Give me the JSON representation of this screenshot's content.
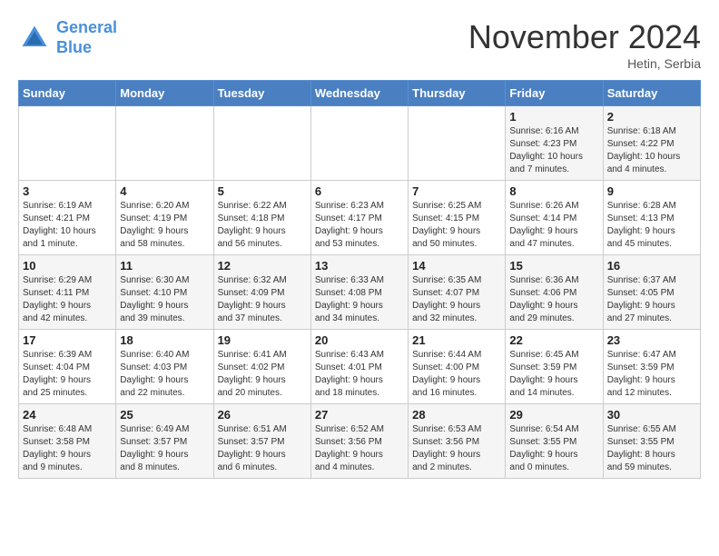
{
  "header": {
    "logo_line1": "General",
    "logo_line2": "Blue",
    "month_title": "November 2024",
    "location": "Hetin, Serbia"
  },
  "weekdays": [
    "Sunday",
    "Monday",
    "Tuesday",
    "Wednesday",
    "Thursday",
    "Friday",
    "Saturday"
  ],
  "weeks": [
    [
      {
        "day": "",
        "info": ""
      },
      {
        "day": "",
        "info": ""
      },
      {
        "day": "",
        "info": ""
      },
      {
        "day": "",
        "info": ""
      },
      {
        "day": "",
        "info": ""
      },
      {
        "day": "1",
        "info": "Sunrise: 6:16 AM\nSunset: 4:23 PM\nDaylight: 10 hours\nand 7 minutes."
      },
      {
        "day": "2",
        "info": "Sunrise: 6:18 AM\nSunset: 4:22 PM\nDaylight: 10 hours\nand 4 minutes."
      }
    ],
    [
      {
        "day": "3",
        "info": "Sunrise: 6:19 AM\nSunset: 4:21 PM\nDaylight: 10 hours\nand 1 minute."
      },
      {
        "day": "4",
        "info": "Sunrise: 6:20 AM\nSunset: 4:19 PM\nDaylight: 9 hours\nand 58 minutes."
      },
      {
        "day": "5",
        "info": "Sunrise: 6:22 AM\nSunset: 4:18 PM\nDaylight: 9 hours\nand 56 minutes."
      },
      {
        "day": "6",
        "info": "Sunrise: 6:23 AM\nSunset: 4:17 PM\nDaylight: 9 hours\nand 53 minutes."
      },
      {
        "day": "7",
        "info": "Sunrise: 6:25 AM\nSunset: 4:15 PM\nDaylight: 9 hours\nand 50 minutes."
      },
      {
        "day": "8",
        "info": "Sunrise: 6:26 AM\nSunset: 4:14 PM\nDaylight: 9 hours\nand 47 minutes."
      },
      {
        "day": "9",
        "info": "Sunrise: 6:28 AM\nSunset: 4:13 PM\nDaylight: 9 hours\nand 45 minutes."
      }
    ],
    [
      {
        "day": "10",
        "info": "Sunrise: 6:29 AM\nSunset: 4:11 PM\nDaylight: 9 hours\nand 42 minutes."
      },
      {
        "day": "11",
        "info": "Sunrise: 6:30 AM\nSunset: 4:10 PM\nDaylight: 9 hours\nand 39 minutes."
      },
      {
        "day": "12",
        "info": "Sunrise: 6:32 AM\nSunset: 4:09 PM\nDaylight: 9 hours\nand 37 minutes."
      },
      {
        "day": "13",
        "info": "Sunrise: 6:33 AM\nSunset: 4:08 PM\nDaylight: 9 hours\nand 34 minutes."
      },
      {
        "day": "14",
        "info": "Sunrise: 6:35 AM\nSunset: 4:07 PM\nDaylight: 9 hours\nand 32 minutes."
      },
      {
        "day": "15",
        "info": "Sunrise: 6:36 AM\nSunset: 4:06 PM\nDaylight: 9 hours\nand 29 minutes."
      },
      {
        "day": "16",
        "info": "Sunrise: 6:37 AM\nSunset: 4:05 PM\nDaylight: 9 hours\nand 27 minutes."
      }
    ],
    [
      {
        "day": "17",
        "info": "Sunrise: 6:39 AM\nSunset: 4:04 PM\nDaylight: 9 hours\nand 25 minutes."
      },
      {
        "day": "18",
        "info": "Sunrise: 6:40 AM\nSunset: 4:03 PM\nDaylight: 9 hours\nand 22 minutes."
      },
      {
        "day": "19",
        "info": "Sunrise: 6:41 AM\nSunset: 4:02 PM\nDaylight: 9 hours\nand 20 minutes."
      },
      {
        "day": "20",
        "info": "Sunrise: 6:43 AM\nSunset: 4:01 PM\nDaylight: 9 hours\nand 18 minutes."
      },
      {
        "day": "21",
        "info": "Sunrise: 6:44 AM\nSunset: 4:00 PM\nDaylight: 9 hours\nand 16 minutes."
      },
      {
        "day": "22",
        "info": "Sunrise: 6:45 AM\nSunset: 3:59 PM\nDaylight: 9 hours\nand 14 minutes."
      },
      {
        "day": "23",
        "info": "Sunrise: 6:47 AM\nSunset: 3:59 PM\nDaylight: 9 hours\nand 12 minutes."
      }
    ],
    [
      {
        "day": "24",
        "info": "Sunrise: 6:48 AM\nSunset: 3:58 PM\nDaylight: 9 hours\nand 9 minutes."
      },
      {
        "day": "25",
        "info": "Sunrise: 6:49 AM\nSunset: 3:57 PM\nDaylight: 9 hours\nand 8 minutes."
      },
      {
        "day": "26",
        "info": "Sunrise: 6:51 AM\nSunset: 3:57 PM\nDaylight: 9 hours\nand 6 minutes."
      },
      {
        "day": "27",
        "info": "Sunrise: 6:52 AM\nSunset: 3:56 PM\nDaylight: 9 hours\nand 4 minutes."
      },
      {
        "day": "28",
        "info": "Sunrise: 6:53 AM\nSunset: 3:56 PM\nDaylight: 9 hours\nand 2 minutes."
      },
      {
        "day": "29",
        "info": "Sunrise: 6:54 AM\nSunset: 3:55 PM\nDaylight: 9 hours\nand 0 minutes."
      },
      {
        "day": "30",
        "info": "Sunrise: 6:55 AM\nSunset: 3:55 PM\nDaylight: 8 hours\nand 59 minutes."
      }
    ]
  ]
}
